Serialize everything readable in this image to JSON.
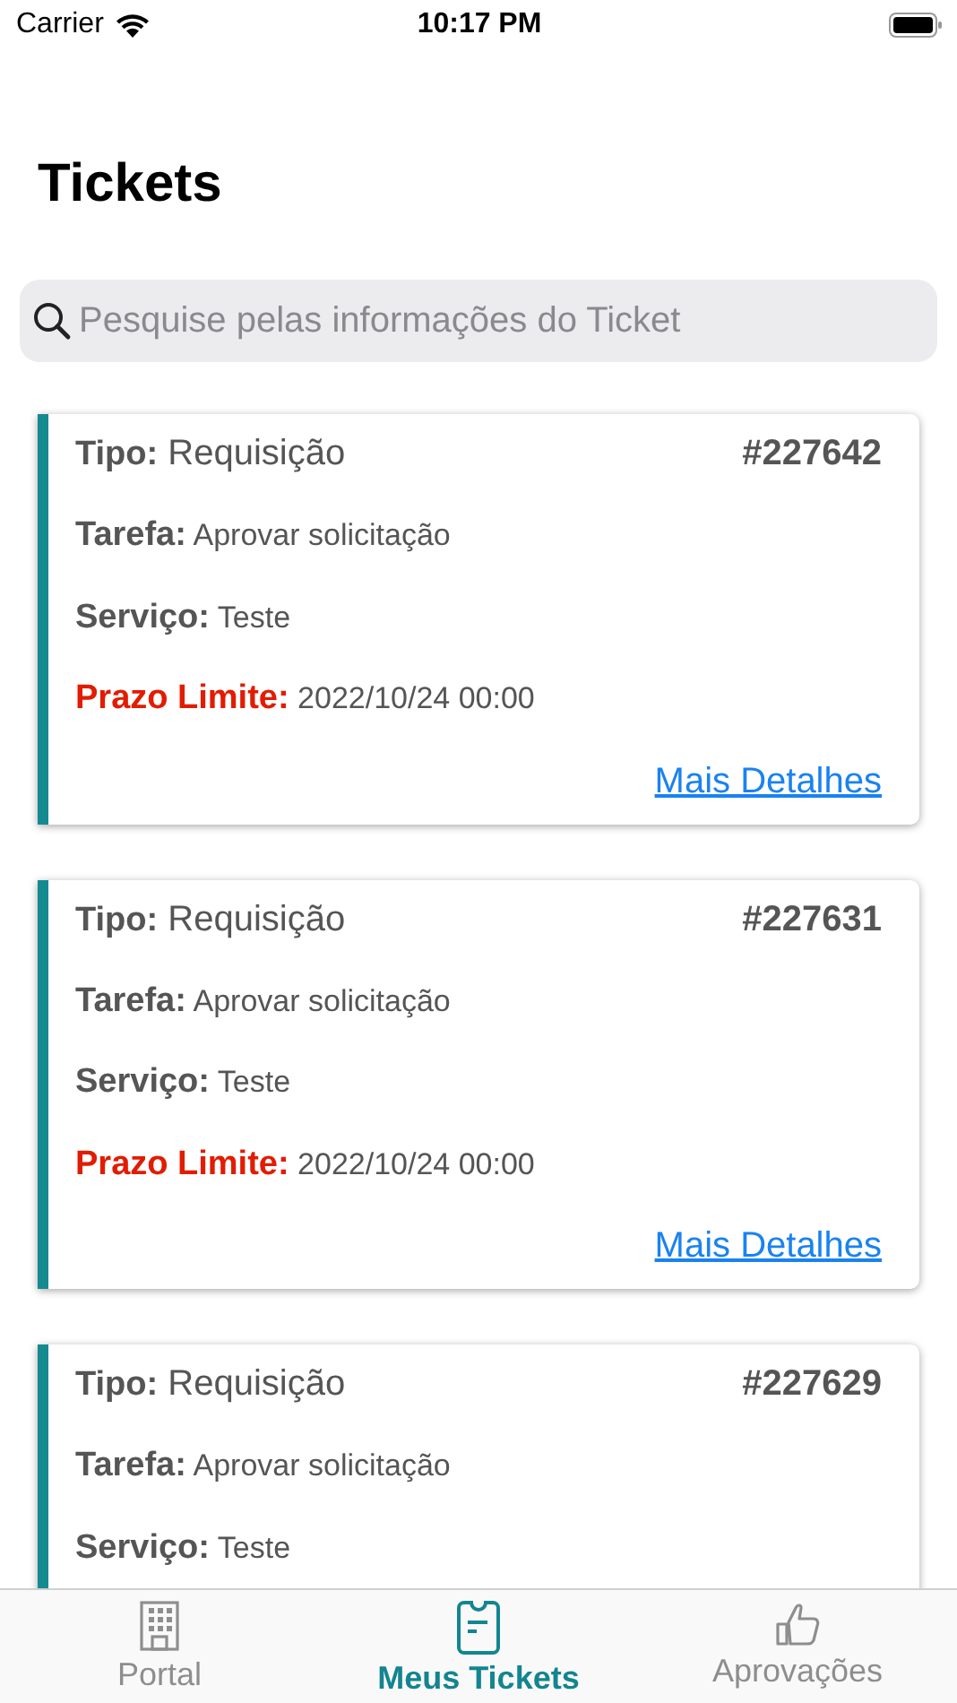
{
  "status_bar": {
    "carrier": "Carrier",
    "time": "10:17 PM"
  },
  "title": "Tickets",
  "search": {
    "placeholder": "Pesquise pelas informações do Ticket"
  },
  "tickets": [
    {
      "type_label": "Tipo:",
      "type": "Requisição",
      "number": "#227642",
      "task_label": "Tarefa:",
      "task": "Aprovar solicitação",
      "service_label": "Serviço:",
      "service": "Teste",
      "deadline_label": "Prazo Limite:",
      "deadline": "2022/10/24 00:00",
      "link": "Mais Detalhes"
    },
    {
      "type_label": "Tipo:",
      "type": "Requisição",
      "number": "#227631",
      "task_label": "Tarefa:",
      "task": "Aprovar solicitação",
      "service_label": "Serviço:",
      "service": "Teste",
      "deadline_label": "Prazo Limite:",
      "deadline": "2022/10/24 00:00",
      "link": "Mais Detalhes"
    },
    {
      "type_label": "Tipo:",
      "type": "Requisição",
      "number": "#227629",
      "task_label": "Tarefa:",
      "task": "Aprovar solicitação",
      "service_label": "Serviço:",
      "service": "Teste"
    }
  ],
  "tab_bar": [
    {
      "kind": "building",
      "label": "Portal",
      "selected": false
    },
    {
      "kind": "ticket",
      "label": "Meus Tickets",
      "selected": true
    },
    {
      "kind": "thumb",
      "label": "Aprovações",
      "selected": false
    }
  ]
}
